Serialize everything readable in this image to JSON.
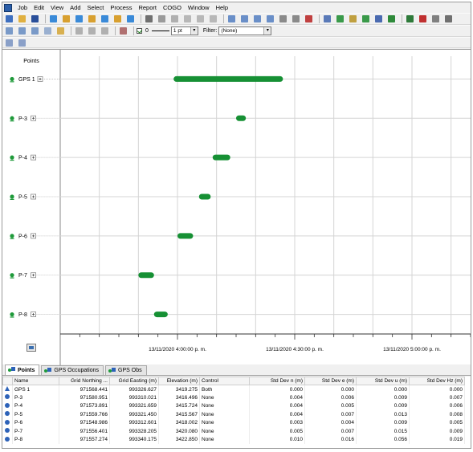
{
  "colors": {
    "bar": "#169034",
    "point_icon": "#1f9a3a",
    "grid": "#d4d4d4",
    "row_icon": "#2d62b8"
  },
  "menu": [
    "Job",
    "Edit",
    "View",
    "Add",
    "Select",
    "Process",
    "Report",
    "COGO",
    "Window",
    "Help"
  ],
  "toolbar": {
    "line_value": "0",
    "line_width": "1 pt",
    "filter_label": "Filter:",
    "filter_value": "(None)"
  },
  "chart": {
    "header": "Points",
    "points": [
      "GPS 1",
      "P-3",
      "P-4",
      "P-5",
      "P-6",
      "P-7",
      "P-8"
    ],
    "time_labels": [
      "13/11/2020 4:00:00 p. m.",
      "13/11/2020 4:30:00 p. m.",
      "13/11/2020 5:00:00 p. m."
    ]
  },
  "chart_data": {
    "type": "bar",
    "subtype": "gantt",
    "categories": [
      "GPS 1",
      "P-3",
      "P-4",
      "P-5",
      "P-6",
      "P-7",
      "P-8"
    ],
    "series": [
      {
        "start_min": [
          -1.0,
          15.0,
          9.0,
          5.5,
          0.0,
          -10.0,
          -6.0
        ],
        "end_min": [
          27.0,
          17.5,
          13.5,
          8.5,
          4.0,
          -6.0,
          -2.5
        ]
      }
    ],
    "xlim_min": [
      -30,
      75
    ],
    "x_reference": "13/11/2020 4:00:00 p. m.",
    "grid": true
  },
  "tabs": [
    "Points",
    "GPS Occupations",
    "GPS Obs"
  ],
  "table": {
    "columns": [
      "",
      "Name",
      "Grid Northing ...",
      "Grid Easting (m)",
      "Elevation (m)",
      "Control",
      "Std Dev n (m)",
      "Std Dev e (m)",
      "Std Dev u (m)",
      "Std Dev Hz (m)"
    ],
    "rows": [
      {
        "icon": "base",
        "name": "GPS 1",
        "northing": "971568.441",
        "easting": "993326.627",
        "elevation": "3419.275",
        "control": "Both",
        "sdn": "0.000",
        "sde": "0.000",
        "sdu": "0.000",
        "sdhz": "0.000"
      },
      {
        "icon": "point",
        "name": "P-3",
        "northing": "971580.951",
        "easting": "993310.021",
        "elevation": "3416.496",
        "control": "None",
        "sdn": "0.004",
        "sde": "0.006",
        "sdu": "0.009",
        "sdhz": "0.007"
      },
      {
        "icon": "point",
        "name": "P-4",
        "northing": "971573.891",
        "easting": "993321.659",
        "elevation": "3415.724",
        "control": "None",
        "sdn": "0.004",
        "sde": "0.005",
        "sdu": "0.009",
        "sdhz": "0.006"
      },
      {
        "icon": "point",
        "name": "P-5",
        "northing": "971559.766",
        "easting": "993321.450",
        "elevation": "3415.567",
        "control": "None",
        "sdn": "0.004",
        "sde": "0.007",
        "sdu": "0.013",
        "sdhz": "0.008"
      },
      {
        "icon": "point",
        "name": "P-6",
        "northing": "971548.986",
        "easting": "993312.601",
        "elevation": "3418.002",
        "control": "None",
        "sdn": "0.003",
        "sde": "0.004",
        "sdu": "0.009",
        "sdhz": "0.005"
      },
      {
        "icon": "point",
        "name": "P-7",
        "northing": "971556.401",
        "easting": "993328.205",
        "elevation": "3420.080",
        "control": "None",
        "sdn": "0.005",
        "sde": "0.007",
        "sdu": "0.015",
        "sdhz": "0.009"
      },
      {
        "icon": "point",
        "name": "P-8",
        "northing": "971557.274",
        "easting": "993340.175",
        "elevation": "3422.850",
        "control": "None",
        "sdn": "0.010",
        "sde": "0.016",
        "sdu": "0.056",
        "sdhz": "0.019"
      }
    ]
  }
}
